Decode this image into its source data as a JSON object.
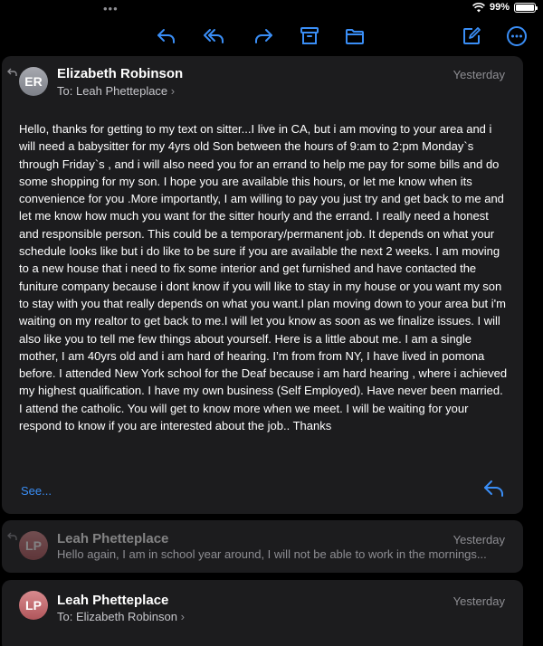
{
  "status": {
    "battery": "99%",
    "battery_level": 0.99
  },
  "toolbar": {
    "icons": [
      "reply-icon",
      "reply-all-icon",
      "forward-icon",
      "archive-icon",
      "folder-icon",
      "compose-icon",
      "more-icon"
    ]
  },
  "messages": [
    {
      "initials": "ER",
      "sender": "Elizabeth Robinson",
      "date": "Yesterday",
      "to_prefix": "To:",
      "to_name": "Leah Phetteplace",
      "body": "Hello, thanks for getting to my text on sitter...I live in CA, but i am moving to your area and i will need a babysitter for my 4yrs old Son between the hours of 9:am to 2:pm Monday`s through Friday`s , and i will also need you for an errand to help me pay for some bills and do some shopping for my son. I hope you are available this hours, or let me know when its convenience for you .More importantly, I am willing to pay you just try and get back to me and let me know how much you want for the sitter hourly and the errand. I really need a honest and responsible person. This could be a temporary/permanent job. It depends on what your schedule looks like but i do like to be sure if you are available the next 2 weeks. I am moving to a new house that i need to fix some interior and get furnished and have contacted the funiture company because i dont know if you will like to stay in my house or you want my son to stay with you that really depends on what you want.I plan moving down to your area but i'm waiting on my realtor to get back to me.I will let you know as soon as we finalize issues. I will also like you to tell me  few things about yourself. Here is a little about me. I am a single mother, I am 40yrs old and i am hard of hearing. I’m from from NY, I have lived in pomona before. I attended New York school for the Deaf because i am hard hearing , where i achieved my highest qualification. I have my own business (Self Employed). Have never been married. I attend the catholic. You will get to know more when we meet. I will be waiting for your respond to know if you are interested about the job.. Thanks",
      "see_more": "See..."
    },
    {
      "initials": "LP",
      "sender": "Leah Phetteplace",
      "date": "Yesterday",
      "snippet": "Hello again, I am in school year around, I will not be able to work in the mornings..."
    },
    {
      "initials": "LP",
      "sender": "Leah Phetteplace",
      "date": "Yesterday",
      "to_prefix": "To:",
      "to_name": "Elizabeth Robinson"
    }
  ]
}
